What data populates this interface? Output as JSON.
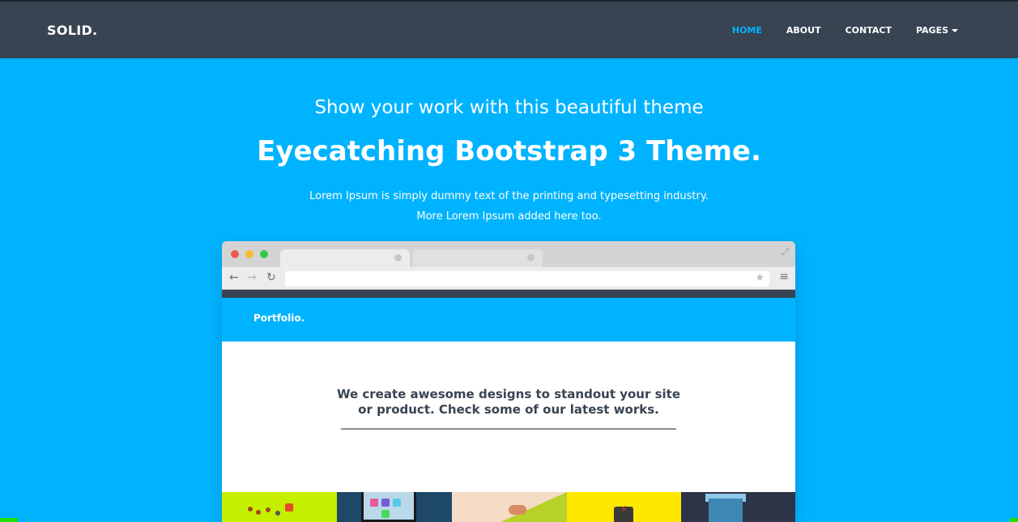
{
  "navbar": {
    "brand": "SOLID.",
    "items": [
      {
        "label": "HOME",
        "active": true
      },
      {
        "label": "ABOUT"
      },
      {
        "label": "CONTACT"
      },
      {
        "label": "PAGES",
        "dropdown": true
      }
    ]
  },
  "hero": {
    "subtitle": "Show your work with this beautiful theme",
    "title": "Eyecatching Bootstrap 3 Theme.",
    "desc_line1": "Lorem Ipsum is simply dummy text of the printing and typesetting industry.",
    "desc_line2": "More Lorem Ipsum added here too."
  },
  "mockup": {
    "brand": "Portfolio.",
    "heading_line1": "We create awesome designs to standout your site",
    "heading_line2": "or product. Check some of our latest works."
  },
  "colors": {
    "primary": "#00b3fe",
    "navbar": "#384452",
    "text": "#ffffff"
  },
  "icons": {
    "back": "arrow-left-icon",
    "forward": "arrow-right-icon",
    "reload": "reload-icon",
    "bookmark": "star-icon",
    "menu": "hamburger-icon",
    "expand": "expand-icon"
  }
}
